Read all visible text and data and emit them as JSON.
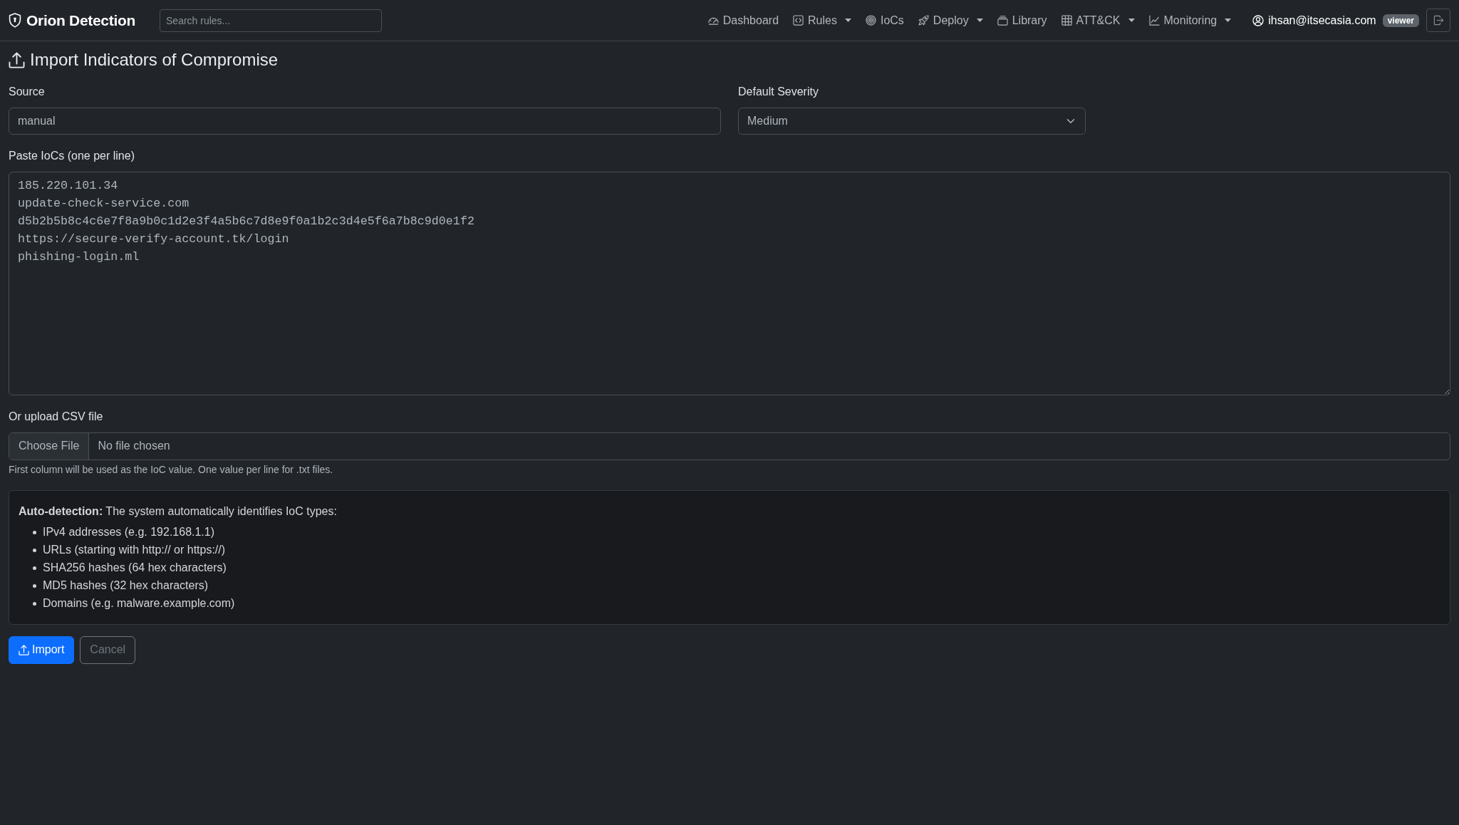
{
  "navbar": {
    "brand": "Orion Detection",
    "search": {
      "placeholder": "Search rules..."
    },
    "nav_items": [
      {
        "label": "Dashboard",
        "dropdown": false,
        "selected": false
      },
      {
        "label": "Rules",
        "dropdown": true,
        "selected": false
      },
      {
        "label": "IoCs",
        "dropdown": false,
        "selected": false
      },
      {
        "label": "Deploy",
        "dropdown": true,
        "selected": false
      },
      {
        "label": "Library",
        "dropdown": false,
        "selected": false
      },
      {
        "label": "ATT&CK",
        "dropdown": true,
        "selected": false
      },
      {
        "label": "Monitoring",
        "dropdown": true,
        "selected": false
      }
    ],
    "user": {
      "email": "ihsan@itsecasia.com",
      "role": "viewer"
    }
  },
  "page_title": "Import Indicators of Compromise",
  "form": {
    "source": {
      "label": "Source",
      "value": "manual"
    },
    "severity": {
      "label": "Default Severity",
      "value": "Medium"
    },
    "iocs": {
      "label": "Paste IoCs (one per line)",
      "value": [
        "185.220.101.34",
        "update-check-service.com",
        "d5b2b5b8c4c6e7f8a9b0c1d2e3f4a5b6c7d8e9f0a1b2c3d4e5f6a7b8c9d0e1f2",
        "https://secure-verify-account.tk/login",
        "phishing-login.ml"
      ]
    },
    "upload": {
      "label": "Or upload CSV file",
      "button": "Choose File",
      "status": "No file chosen",
      "help": "First column will be used as the IoC value. One value per line for .txt files."
    },
    "auto_detection": {
      "text": "**Auto-detection:** The system automatically identifies IoC types:",
      "items": [
        "IPv4 addresses (e.g. 192.168.1.1)",
        "URLs (starting with http:// or https://)",
        "SHA256 hashes (64 hex characters)",
        "MD5 hashes (32 hex characters)",
        "Domains (e.g. malware.example.com)"
      ]
    },
    "buttons": [
      {
        "label": "Import",
        "kind": "submit"
      },
      {
        "label": "Cancel",
        "kind": "cancel"
      }
    ]
  }
}
